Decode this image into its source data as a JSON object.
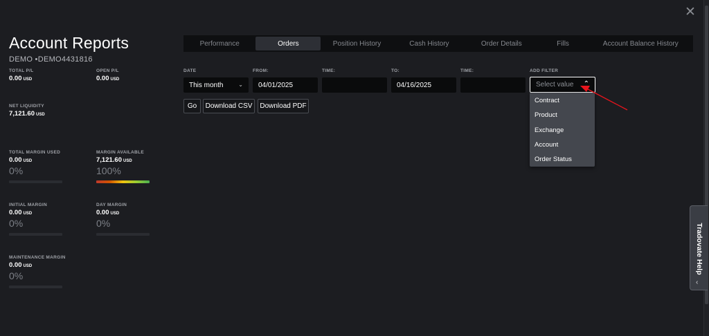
{
  "window": {
    "close_icon": "close-icon"
  },
  "header": {
    "title": "Account Reports",
    "account": "DEMO •DEMO4431816"
  },
  "metrics": {
    "total_pl": {
      "label": "TOTAL P/L",
      "value": "0.00",
      "unit": "USD"
    },
    "open_pl": {
      "label": "OPEN P/L",
      "value": "0.00",
      "unit": "USD"
    },
    "net_liquidity": {
      "label": "NET LIQUIDITY",
      "value": "7,121.60",
      "unit": "USD"
    },
    "total_margin_used": {
      "label": "TOTAL MARGIN USED",
      "value": "0.00",
      "unit": "USD",
      "pct": "0%",
      "level": 0
    },
    "margin_available": {
      "label": "MARGIN AVAILABLE",
      "value": "7,121.60",
      "unit": "USD",
      "pct": "100%",
      "level": 1.0
    },
    "initial_margin": {
      "label": "INITIAL MARGIN",
      "value": "0.00",
      "unit": "USD",
      "pct": "0%",
      "level": 0
    },
    "day_margin": {
      "label": "DAY MARGIN",
      "value": "0.00",
      "unit": "USD",
      "pct": "0%",
      "level": 0
    },
    "maintenance_margin": {
      "label": "MAINTENANCE MARGIN",
      "value": "0.00",
      "unit": "USD",
      "pct": "0%",
      "level": 0
    }
  },
  "tabs": [
    {
      "label": "Performance",
      "active": false
    },
    {
      "label": "Orders",
      "active": true
    },
    {
      "label": "Position History",
      "active": false
    },
    {
      "label": "Cash History",
      "active": false
    },
    {
      "label": "Order Details",
      "active": false
    },
    {
      "label": "Fills",
      "active": false
    },
    {
      "label": "Account Balance History",
      "active": false
    }
  ],
  "filters": {
    "date_label": "DATE",
    "date_value": "This month",
    "from_label": "FROM:",
    "from_value": "04/01/2025",
    "time1_label": "TIME:",
    "time1_value": "",
    "to_label": "TO:",
    "to_value": "04/16/2025",
    "time2_label": "TIME:",
    "time2_value": "",
    "add_filter_label": "ADD FILTER",
    "add_filter_placeholder": "Select value"
  },
  "buttons": {
    "go": "Go",
    "csv": "Download CSV",
    "pdf": "Download PDF"
  },
  "dropdown_options": [
    "Contract",
    "Product",
    "Exchange",
    "Account",
    "Order Status"
  ],
  "help": {
    "label": "Tradovate Help"
  },
  "colors": {
    "background": "#1c1d21",
    "annotation_arrow": "#e8141c",
    "accent_white": "#ffffff"
  }
}
